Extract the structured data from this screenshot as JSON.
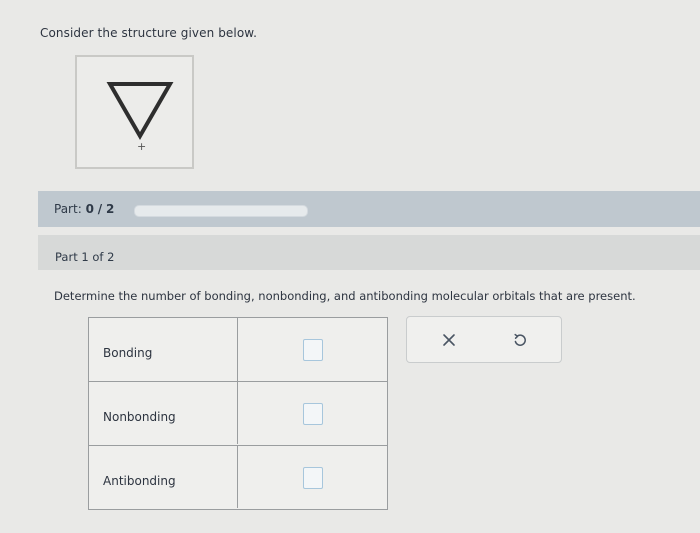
{
  "question_intro": "Consider the structure given below.",
  "structure": {
    "charge_symbol": "+"
  },
  "part_progress": {
    "label": "Part:",
    "current": "0",
    "separator": "/",
    "total": "2",
    "progress_fraction": 0
  },
  "part_header": "Part 1 of 2",
  "question": "Determine the number of bonding, nonbonding, and antibonding molecular orbitals that are present.",
  "answer_rows": [
    {
      "label": "Bonding",
      "value": ""
    },
    {
      "label": "Nonbonding",
      "value": ""
    },
    {
      "label": "Antibonding",
      "value": ""
    }
  ],
  "actions": {
    "clear_icon": "close-icon",
    "reset_icon": "undo-icon"
  },
  "colors": {
    "progress_fill": "#5c8bb8",
    "part_bar": "#bfc8cf",
    "input_border": "#a7c6dc"
  }
}
